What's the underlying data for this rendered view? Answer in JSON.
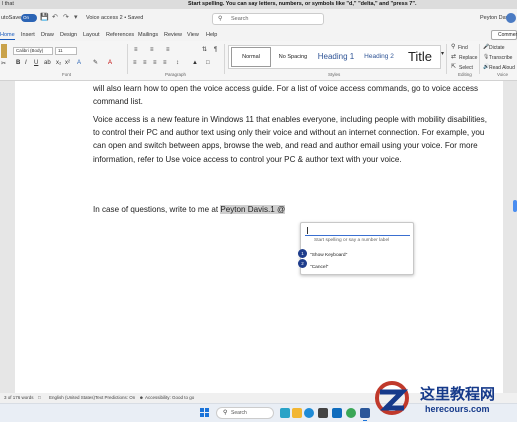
{
  "voice_bar": {
    "left_text": "l that",
    "message": "Start spelling. You can say letters, numbers, or symbols like \"d,\" \"delta,\" and \"press 7\"."
  },
  "title_bar": {
    "autosave_label": "utoSave",
    "autosave_state": "On",
    "doc_title": "Voice access 2 • Saved",
    "search_placeholder": "Search",
    "user_name": "Peyton Davis"
  },
  "menu": {
    "tabs": [
      "Home",
      "Insert",
      "Draw",
      "Design",
      "Layout",
      "References",
      "Mailings",
      "Review",
      "View",
      "Help"
    ],
    "active_tab": "Home",
    "comments_label": "Comments"
  },
  "ribbon": {
    "font_name": "Calibri (Body)",
    "font_size": "11",
    "groups": {
      "font": "Font",
      "paragraph": "Paragraph",
      "styles": "Styles",
      "editing": "Editing",
      "voice": "Voice"
    },
    "styles": {
      "normal": "Normal",
      "no_spacing": "No Spacing",
      "heading1": "Heading 1",
      "heading2": "Heading 2",
      "title": "Title"
    },
    "editing": {
      "find": "Find",
      "replace": "Replace",
      "select": "Select"
    },
    "voice": {
      "dictate": "Dictate",
      "transcribe": "Transcribe",
      "read_aloud": "Read Aloud"
    }
  },
  "document": {
    "para1": "will also learn how to open the voice access guide. For a list of voice access commands, go to voice access command list.",
    "para2": "Voice access is a new feature in Windows 11 that enables everyone, including people with mobility disabilities, to control their PC and author text using only their voice and without an internet connection. For example, you can open and switch between apps, browse the web, and read and author email using your voice. For more information, refer to Use voice access to control your PC & author text with your voice.",
    "para3_prefix": "In case of questions, write to me at ",
    "mention": "Peyton Davis.1 @"
  },
  "voice_popup": {
    "placeholder": "Start spelling or say a number label",
    "options": [
      {
        "number": "1",
        "label": "\"Show Keyboard\""
      },
      {
        "number": "2",
        "label": "\"Cancel\""
      }
    ]
  },
  "status_bar": {
    "words": "3 of 176 words",
    "language": "English (United States)",
    "predictions": "Text Predictions: On",
    "accessibility": "Accessibility: Good to go"
  },
  "taskbar": {
    "search_label": "Search"
  },
  "watermark": {
    "cn": "这里教程网",
    "en": "herecours.com"
  },
  "colors": {
    "accent": "#185abd",
    "mention_highlight": "#cfcfcf",
    "popup_number": "#1f3d8c"
  }
}
